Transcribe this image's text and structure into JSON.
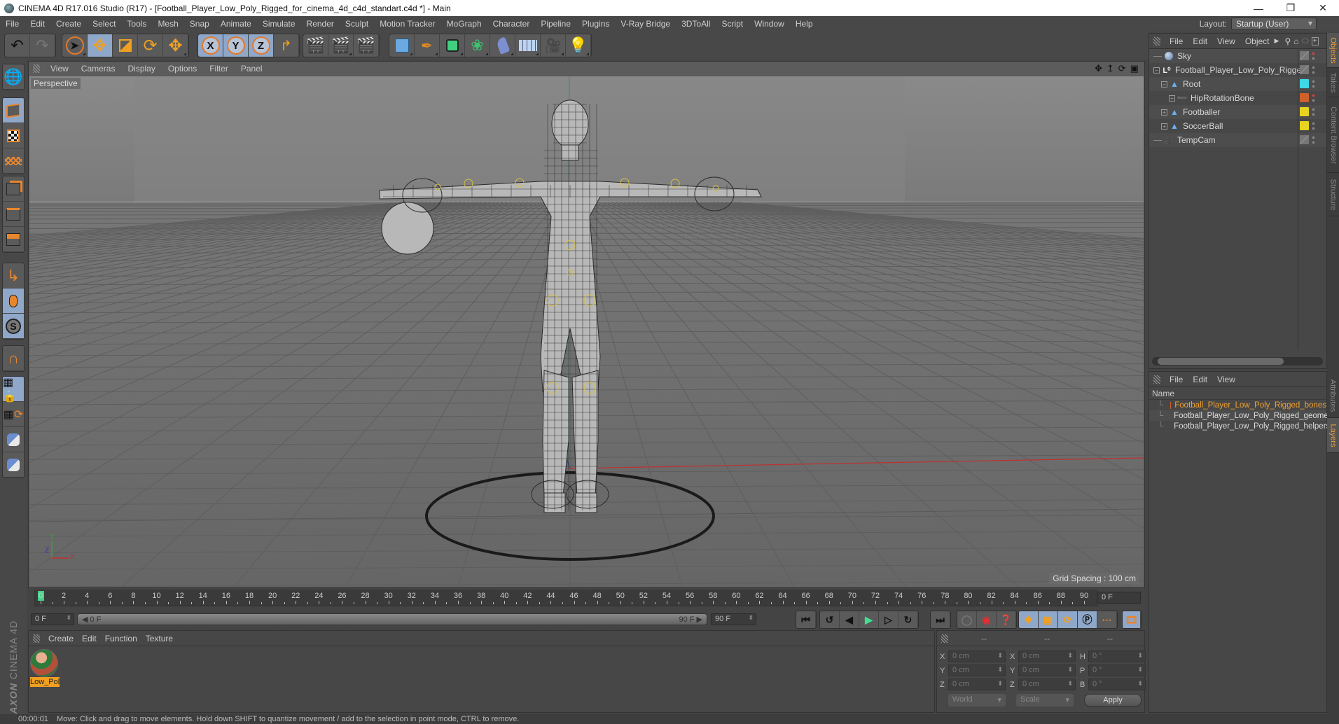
{
  "window": {
    "title": "CINEMA 4D R17.016 Studio (R17) - [Football_Player_Low_Poly_Rigged_for_cinema_4d_c4d_standart.c4d *] - Main",
    "controls": [
      "minimize",
      "restore",
      "close"
    ]
  },
  "menubar": {
    "items": [
      "File",
      "Edit",
      "Create",
      "Select",
      "Tools",
      "Mesh",
      "Snap",
      "Animate",
      "Simulate",
      "Render",
      "Sculpt",
      "Motion Tracker",
      "MoGraph",
      "Character",
      "Pipeline",
      "Plugins",
      "V-Ray Bridge",
      "3DToAll",
      "Script",
      "Window",
      "Help"
    ],
    "layout_label": "Layout:",
    "layout_value": "Startup (User)"
  },
  "toolbar": {
    "undo": "undo-icon",
    "redo": "redo-icon",
    "tools": [
      "live-selection",
      "move",
      "scale",
      "rotate",
      "recent-transform"
    ],
    "axis_locks": [
      "X",
      "Y",
      "Z"
    ],
    "coord_system": "world-coordinates",
    "render": [
      "render-view",
      "render-to-picture-viewer",
      "edit-render-settings"
    ],
    "objects": [
      "cube",
      "pen-spline",
      "subdivision",
      "cloner",
      "deformer-bend",
      "floor",
      "camera",
      "light"
    ]
  },
  "left_tools": [
    "make-editable",
    "model-mode",
    "texture-mode",
    "workplane-mode",
    "points-mode",
    "edges-mode",
    "polygons-mode",
    "enable-axis",
    "tweak-mode",
    "solo",
    "snap",
    "workplane-lock",
    "workplane-align",
    "python-script-1",
    "python-script-2"
  ],
  "viewport": {
    "menu": [
      "View",
      "Cameras",
      "Display",
      "Options",
      "Filter",
      "Panel"
    ],
    "camera_label": "Perspective",
    "grid_spacing": "Grid Spacing : 100 cm",
    "axis_labels": {
      "x": "X",
      "y": "Y",
      "z": "Z"
    },
    "nav_icons": [
      "move-view",
      "zoom-view",
      "rotate-view",
      "toggle-layout"
    ]
  },
  "timeline": {
    "ticks": [
      0,
      2,
      4,
      6,
      8,
      10,
      12,
      14,
      16,
      18,
      20,
      22,
      24,
      26,
      28,
      30,
      32,
      34,
      36,
      38,
      40,
      42,
      44,
      46,
      48,
      50,
      52,
      54,
      56,
      58,
      60,
      62,
      64,
      66,
      68,
      70,
      72,
      74,
      76,
      78,
      80,
      82,
      84,
      86,
      88,
      90
    ],
    "current_frame": 0,
    "current_frame_field": "0 F",
    "start_field": "0 F",
    "range_start": "0 F",
    "range_end": "90 F",
    "end_field": "90 F",
    "playback": [
      "go-to-start",
      "previous-key",
      "previous-frame",
      "play",
      "next-frame",
      "next-key",
      "go-to-end"
    ],
    "key_buttons": [
      "autokey-off",
      "record",
      "autokeying-help"
    ],
    "key_tracks": [
      "position",
      "scale",
      "rotation",
      "parameter",
      "point-level"
    ],
    "timeline_button": "open-timeline"
  },
  "materials": {
    "menu": [
      "Create",
      "Edit",
      "Function",
      "Texture"
    ],
    "items": [
      {
        "name": "Low_Pol"
      }
    ]
  },
  "coordinates": {
    "headers": [
      "--",
      "--",
      "--"
    ],
    "position": [
      {
        "axis": "X",
        "value": "0 cm"
      },
      {
        "axis": "Y",
        "value": "0 cm"
      },
      {
        "axis": "Z",
        "value": "0 cm"
      }
    ],
    "size": [
      {
        "axis": "X",
        "value": "0 cm"
      },
      {
        "axis": "Y",
        "value": "0 cm"
      },
      {
        "axis": "Z",
        "value": "0 cm"
      }
    ],
    "rotation": [
      {
        "axis": "H",
        "value": "0 °"
      },
      {
        "axis": "P",
        "value": "0 °"
      },
      {
        "axis": "B",
        "value": "0 °"
      }
    ],
    "space": "World",
    "mode": "Scale",
    "apply": "Apply"
  },
  "object_manager": {
    "menu": [
      "File",
      "Edit",
      "View",
      "Object"
    ],
    "objects": [
      {
        "name": "Sky",
        "indent": 0,
        "icon": "sky-icon",
        "expander": "",
        "tag": "gray",
        "dot": "#e04040"
      },
      {
        "name": "Football_Player_Low_Poly_Rigged",
        "indent": 0,
        "icon": "null-icon",
        "expander": "-",
        "tag": "gray",
        "dot": ""
      },
      {
        "name": "Root",
        "indent": 1,
        "icon": "joint-icon",
        "expander": "-",
        "tag": "#3ed8e6",
        "dot": ""
      },
      {
        "name": "HipRotationBone",
        "indent": 2,
        "icon": "bone-icon",
        "expander": "+",
        "tag": "#d0602a",
        "dot": "#e04040"
      },
      {
        "name": "Footballer",
        "indent": 1,
        "icon": "joint-icon",
        "expander": "+",
        "tag": "#e6d420",
        "dot": ""
      },
      {
        "name": "SoccerBall",
        "indent": 1,
        "icon": "joint-icon",
        "expander": "+",
        "tag": "#e6d420",
        "dot": ""
      },
      {
        "name": "TempCam",
        "indent": 0,
        "icon": "camera-icon",
        "expander": "",
        "tag": "gray",
        "dot": ""
      }
    ]
  },
  "layer_manager": {
    "menu": [
      "File",
      "Edit",
      "View"
    ],
    "column_name": "Name",
    "layers": [
      {
        "name": "Football_Player_Low_Poly_Rigged_bones",
        "color": "#d0602a",
        "selected": true
      },
      {
        "name": "Football_Player_Low_Poly_Rigged_geomet",
        "color": "#e6d420",
        "selected": false
      },
      {
        "name": "Football_Player_Low_Poly_Rigged_helpers",
        "color": "#3ed8e6",
        "selected": false
      }
    ]
  },
  "right_tabs": {
    "top": [
      "Objects",
      "Takes",
      "Content Browser",
      "Structure"
    ],
    "bottom": [
      "Attributes",
      "Layers"
    ]
  },
  "branding": {
    "maxon": "MAXON",
    "product": "CINEMA 4D"
  },
  "status": {
    "time": "00:00:01",
    "message": "Move: Click and drag to move elements. Hold down SHIFT to quantize movement / add to the selection in point mode, CTRL to remove."
  }
}
